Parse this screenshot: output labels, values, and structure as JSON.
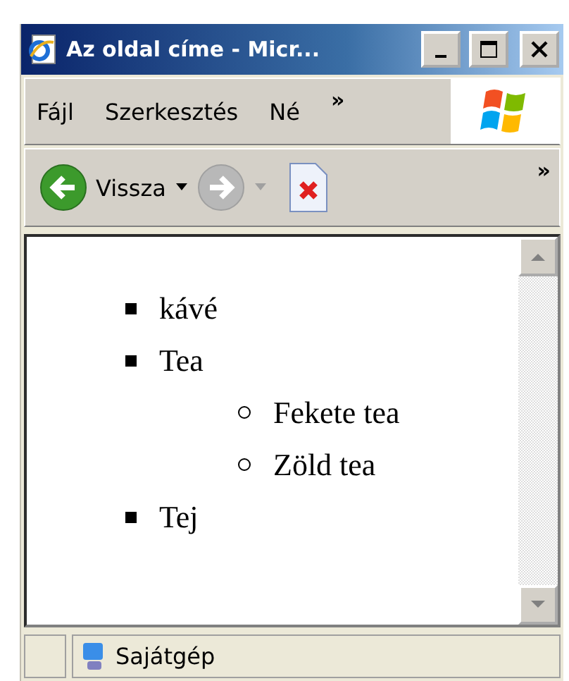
{
  "window": {
    "title": "Az oldal címe - Micr..."
  },
  "menu_bar": {
    "items": [
      {
        "label": "Fájl"
      },
      {
        "label": "Szerkesztés"
      },
      {
        "label": "Né"
      }
    ],
    "overflow": "»"
  },
  "toolbar": {
    "back": {
      "label": "Vissza"
    },
    "forward": {
      "disabled": true
    },
    "overflow": "»"
  },
  "content": {
    "list": [
      {
        "text": "kávé"
      },
      {
        "text": "Tea",
        "children": [
          {
            "text": "Fekete tea"
          },
          {
            "text": "Zöld tea"
          }
        ]
      },
      {
        "text": "Tej"
      }
    ]
  },
  "status_bar": {
    "text": "Sajátgép"
  }
}
